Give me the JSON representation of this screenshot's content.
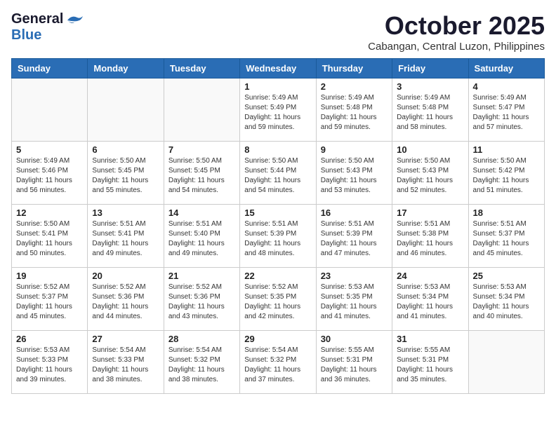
{
  "header": {
    "logo_general": "General",
    "logo_blue": "Blue",
    "month": "October 2025",
    "location": "Cabangan, Central Luzon, Philippines"
  },
  "weekdays": [
    "Sunday",
    "Monday",
    "Tuesday",
    "Wednesday",
    "Thursday",
    "Friday",
    "Saturday"
  ],
  "weeks": [
    [
      {
        "day": "",
        "info": ""
      },
      {
        "day": "",
        "info": ""
      },
      {
        "day": "",
        "info": ""
      },
      {
        "day": "1",
        "info": "Sunrise: 5:49 AM\nSunset: 5:49 PM\nDaylight: 11 hours\nand 59 minutes."
      },
      {
        "day": "2",
        "info": "Sunrise: 5:49 AM\nSunset: 5:48 PM\nDaylight: 11 hours\nand 59 minutes."
      },
      {
        "day": "3",
        "info": "Sunrise: 5:49 AM\nSunset: 5:48 PM\nDaylight: 11 hours\nand 58 minutes."
      },
      {
        "day": "4",
        "info": "Sunrise: 5:49 AM\nSunset: 5:47 PM\nDaylight: 11 hours\nand 57 minutes."
      }
    ],
    [
      {
        "day": "5",
        "info": "Sunrise: 5:49 AM\nSunset: 5:46 PM\nDaylight: 11 hours\nand 56 minutes."
      },
      {
        "day": "6",
        "info": "Sunrise: 5:50 AM\nSunset: 5:45 PM\nDaylight: 11 hours\nand 55 minutes."
      },
      {
        "day": "7",
        "info": "Sunrise: 5:50 AM\nSunset: 5:45 PM\nDaylight: 11 hours\nand 54 minutes."
      },
      {
        "day": "8",
        "info": "Sunrise: 5:50 AM\nSunset: 5:44 PM\nDaylight: 11 hours\nand 54 minutes."
      },
      {
        "day": "9",
        "info": "Sunrise: 5:50 AM\nSunset: 5:43 PM\nDaylight: 11 hours\nand 53 minutes."
      },
      {
        "day": "10",
        "info": "Sunrise: 5:50 AM\nSunset: 5:43 PM\nDaylight: 11 hours\nand 52 minutes."
      },
      {
        "day": "11",
        "info": "Sunrise: 5:50 AM\nSunset: 5:42 PM\nDaylight: 11 hours\nand 51 minutes."
      }
    ],
    [
      {
        "day": "12",
        "info": "Sunrise: 5:50 AM\nSunset: 5:41 PM\nDaylight: 11 hours\nand 50 minutes."
      },
      {
        "day": "13",
        "info": "Sunrise: 5:51 AM\nSunset: 5:41 PM\nDaylight: 11 hours\nand 49 minutes."
      },
      {
        "day": "14",
        "info": "Sunrise: 5:51 AM\nSunset: 5:40 PM\nDaylight: 11 hours\nand 49 minutes."
      },
      {
        "day": "15",
        "info": "Sunrise: 5:51 AM\nSunset: 5:39 PM\nDaylight: 11 hours\nand 48 minutes."
      },
      {
        "day": "16",
        "info": "Sunrise: 5:51 AM\nSunset: 5:39 PM\nDaylight: 11 hours\nand 47 minutes."
      },
      {
        "day": "17",
        "info": "Sunrise: 5:51 AM\nSunset: 5:38 PM\nDaylight: 11 hours\nand 46 minutes."
      },
      {
        "day": "18",
        "info": "Sunrise: 5:51 AM\nSunset: 5:37 PM\nDaylight: 11 hours\nand 45 minutes."
      }
    ],
    [
      {
        "day": "19",
        "info": "Sunrise: 5:52 AM\nSunset: 5:37 PM\nDaylight: 11 hours\nand 45 minutes."
      },
      {
        "day": "20",
        "info": "Sunrise: 5:52 AM\nSunset: 5:36 PM\nDaylight: 11 hours\nand 44 minutes."
      },
      {
        "day": "21",
        "info": "Sunrise: 5:52 AM\nSunset: 5:36 PM\nDaylight: 11 hours\nand 43 minutes."
      },
      {
        "day": "22",
        "info": "Sunrise: 5:52 AM\nSunset: 5:35 PM\nDaylight: 11 hours\nand 42 minutes."
      },
      {
        "day": "23",
        "info": "Sunrise: 5:53 AM\nSunset: 5:35 PM\nDaylight: 11 hours\nand 41 minutes."
      },
      {
        "day": "24",
        "info": "Sunrise: 5:53 AM\nSunset: 5:34 PM\nDaylight: 11 hours\nand 41 minutes."
      },
      {
        "day": "25",
        "info": "Sunrise: 5:53 AM\nSunset: 5:34 PM\nDaylight: 11 hours\nand 40 minutes."
      }
    ],
    [
      {
        "day": "26",
        "info": "Sunrise: 5:53 AM\nSunset: 5:33 PM\nDaylight: 11 hours\nand 39 minutes."
      },
      {
        "day": "27",
        "info": "Sunrise: 5:54 AM\nSunset: 5:33 PM\nDaylight: 11 hours\nand 38 minutes."
      },
      {
        "day": "28",
        "info": "Sunrise: 5:54 AM\nSunset: 5:32 PM\nDaylight: 11 hours\nand 38 minutes."
      },
      {
        "day": "29",
        "info": "Sunrise: 5:54 AM\nSunset: 5:32 PM\nDaylight: 11 hours\nand 37 minutes."
      },
      {
        "day": "30",
        "info": "Sunrise: 5:55 AM\nSunset: 5:31 PM\nDaylight: 11 hours\nand 36 minutes."
      },
      {
        "day": "31",
        "info": "Sunrise: 5:55 AM\nSunset: 5:31 PM\nDaylight: 11 hours\nand 35 minutes."
      },
      {
        "day": "",
        "info": ""
      }
    ]
  ]
}
